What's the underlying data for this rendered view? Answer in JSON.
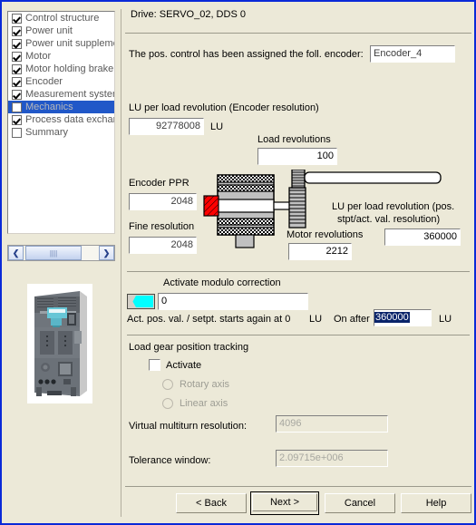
{
  "window": {
    "accent_border": "#0a2ad8",
    "background": "#ece9d8"
  },
  "sidebar": {
    "steps": [
      {
        "label": "Control structure",
        "checked": true,
        "selected": false
      },
      {
        "label": "Power unit",
        "checked": true,
        "selected": false
      },
      {
        "label": "Power unit supplement",
        "checked": true,
        "selected": false
      },
      {
        "label": "Motor",
        "checked": true,
        "selected": false
      },
      {
        "label": "Motor holding brake",
        "checked": true,
        "selected": false
      },
      {
        "label": "Encoder",
        "checked": true,
        "selected": false
      },
      {
        "label": "Measurement system",
        "checked": true,
        "selected": false
      },
      {
        "label": "Mechanics",
        "checked": false,
        "selected": true
      },
      {
        "label": "Process data exchang",
        "checked": true,
        "selected": false
      },
      {
        "label": "Summary",
        "checked": false,
        "selected": false
      }
    ],
    "scrollbar": {
      "left_arrow": "❮",
      "right_arrow": "❯",
      "thumb_grip": "||||"
    },
    "device_image_alt": "drive-device-photo"
  },
  "main": {
    "title": "Drive: SERVO_02, DDS 0",
    "encoder_assign_label": "The pos. control has been assigned the foll. encoder:",
    "encoder_assign_value": "Encoder_4",
    "lu_per_load_rev_label": "LU per load revolution (Encoder resolution)",
    "lu_per_load_rev_value": "92778008",
    "lu_unit": "LU",
    "load_revolutions_label": "Load revolutions",
    "load_revolutions_value": "100",
    "encoder_ppr_label": "Encoder PPR",
    "encoder_ppr_value": "2048",
    "fine_resolution_label": "Fine resolution",
    "fine_resolution_value": "2048",
    "motor_revolutions_label": "Motor revolutions",
    "motor_revolutions_value": "2212",
    "lu_per_load_rev_pos_label_line1": "LU per load revolution (pos.",
    "lu_per_load_rev_pos_label_line2": "stpt/act. val. resolution)",
    "lu_per_load_rev_pos_value": "360000",
    "modulo": {
      "activate_label": "Activate modulo correction",
      "value": "0",
      "starts_again_label": "Act. pos. val. / setpt. starts again at 0",
      "unit_left": "LU",
      "on_after_label": "On after",
      "on_after_value": "360000",
      "unit_right": "LU"
    },
    "load_gear": {
      "group_label": "Load gear position tracking",
      "activate_label": "Activate",
      "activate_checked": false,
      "rotary_axis_label": "Rotary axis",
      "linear_axis_label": "Linear axis",
      "virtual_multiturn_label": "Virtual multiturn resolution:",
      "virtual_multiturn_value": "4096",
      "tolerance_window_label": "Tolerance window:",
      "tolerance_window_value": "2.09715e+006"
    }
  },
  "buttons": {
    "back": "< Back",
    "next": "Next >",
    "cancel": "Cancel",
    "help": "Help"
  }
}
